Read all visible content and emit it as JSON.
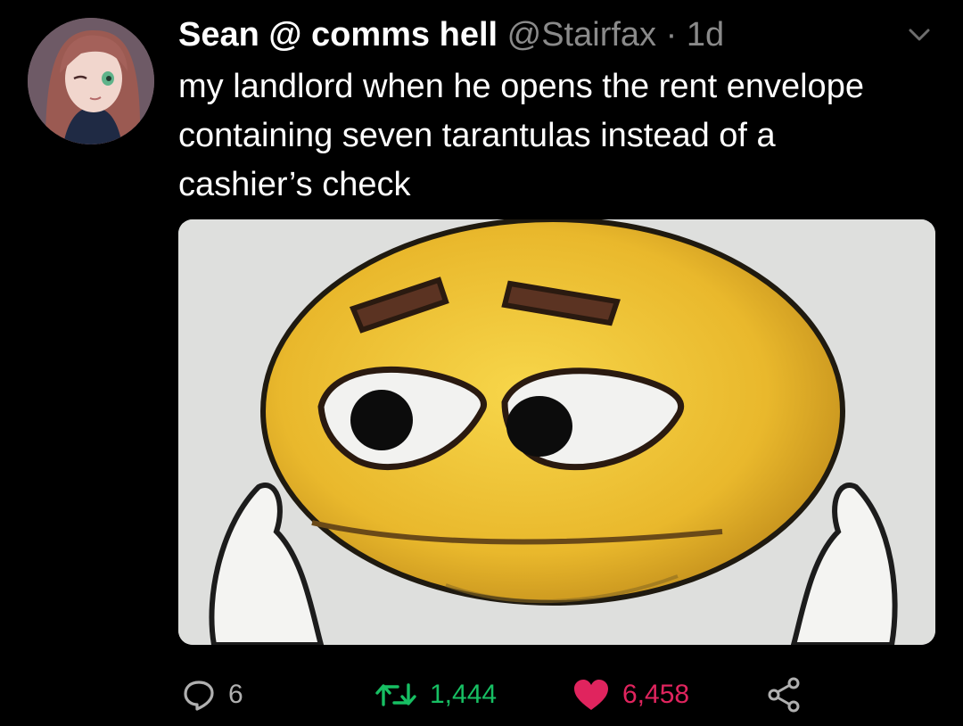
{
  "tweet": {
    "display_name": "Sean @ comms hell",
    "handle": "@Stairfax",
    "separator": "·",
    "timestamp": "1d",
    "lines": [
      "my landlord when he opens the rent envelope",
      "containing seven tarantulas instead of a",
      "cashier’s check"
    ],
    "media_icon": "emoji-face-image",
    "avatar_icon": "anime-avatar"
  },
  "actions": {
    "reply": {
      "icon": "reply-icon",
      "count": "6"
    },
    "retweet": {
      "icon": "retweet-icon",
      "count": "1,444"
    },
    "like": {
      "icon": "heart-icon",
      "count": "6,458"
    },
    "share": {
      "icon": "share-icon"
    }
  },
  "colors": {
    "background": "#000000",
    "text": "#ffffff",
    "muted": "#8a8a8a",
    "retweet": "#17bf63",
    "like": "#e0245e"
  }
}
